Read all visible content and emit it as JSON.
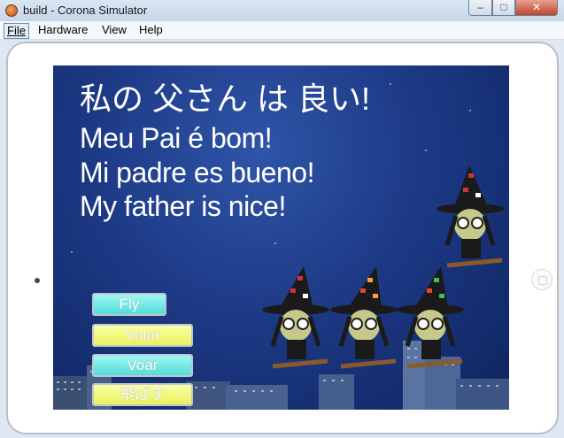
{
  "window": {
    "title": "build - Corona Simulator",
    "controls": {
      "minimize": "–",
      "maximize": "□",
      "close": "✕"
    }
  },
  "menu": [
    "File",
    "Hardware",
    "View",
    "Help"
  ],
  "app": {
    "lines": [
      "私の 父さん は 良い!",
      "Meu Pai é bom!",
      "Mi padre es bueno!",
      "My father is nice!"
    ],
    "buttons": [
      {
        "label": "Fly",
        "color": "#5fe1de"
      },
      {
        "label": "Volar",
        "color": "#eef562"
      },
      {
        "label": "Voar",
        "color": "#5fe1de"
      },
      {
        "label": "飛ばす",
        "color": "#eef562"
      }
    ]
  },
  "colors": {
    "sky_top": "#2f55a8",
    "sky_bottom": "#0f245f",
    "cyan_button": "#5fe1de",
    "yellow_button": "#eef562"
  }
}
